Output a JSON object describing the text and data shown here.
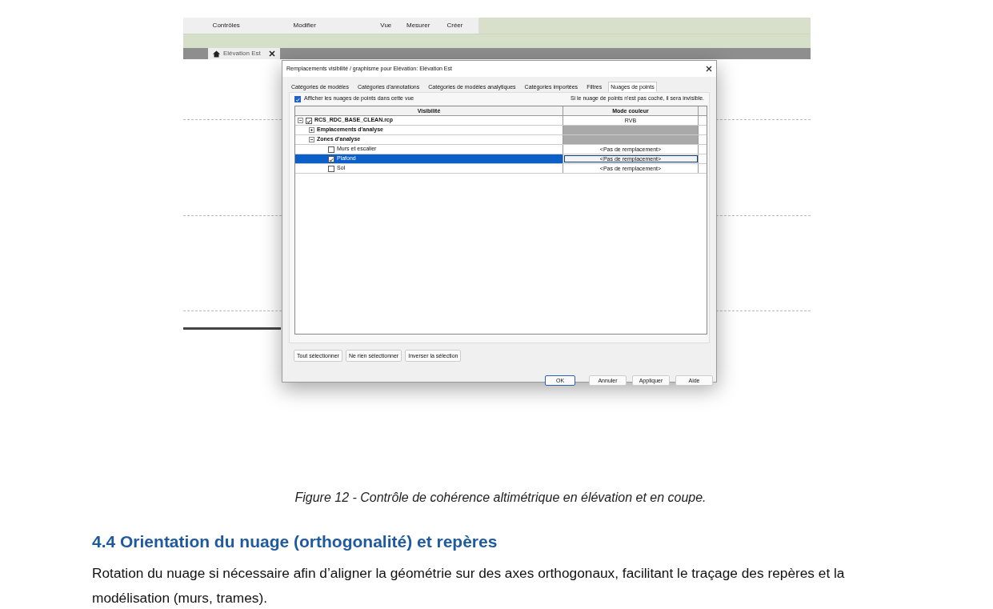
{
  "ribbon_tabs": [
    "Contrôles",
    "Modifier",
    "Vue",
    "Mesurer",
    "Créer"
  ],
  "view_tab": {
    "label": "Elévation Est"
  },
  "dialog": {
    "title": "Remplacements visibilité / graphisme pour Elévation: Elévation Est",
    "tabs": [
      {
        "label": "Catégories de modèles",
        "selected": false
      },
      {
        "label": "Catégories d'annotations",
        "selected": false
      },
      {
        "label": "Catégories de modèles analytiques",
        "selected": false
      },
      {
        "label": "Catégories importées",
        "selected": false
      },
      {
        "label": "Filtres",
        "selected": false
      },
      {
        "label": "Nuages de points",
        "selected": true
      }
    ],
    "show_checkbox": {
      "label": "Afficher les nuages de points dans cette vue",
      "checked": true
    },
    "note": "Si le nuage de points n'est pas coché, il sera invisible.",
    "columns": [
      "Visibilité",
      "Mode couleur"
    ],
    "rows": [
      {
        "label": "RCS_RDC_BASE_CLEAN.rcp",
        "checked": true,
        "expanded": true,
        "selected": false,
        "mode": "RVB",
        "children": [
          {
            "label": "Emplacements d'analyse",
            "expanded": false,
            "selected": false
          },
          {
            "label": "Zones d'analyse",
            "expanded": true,
            "selected": false,
            "children": [
              {
                "label": "Murs et escalier",
                "checked": false,
                "selected": false,
                "mode": "<Pas de remplacement>"
              },
              {
                "label": "Plafond",
                "checked": true,
                "selected": true,
                "mode": "<Pas de remplacement>"
              },
              {
                "label": "Sol",
                "checked": false,
                "selected": false,
                "mode": "<Pas de remplacement>"
              }
            ]
          }
        ]
      }
    ],
    "select_buttons": [
      "Tout sélectionner",
      "Ne rien sélectionner",
      "Inverser la sélection"
    ],
    "buttons": [
      {
        "label": "OK",
        "focused": true
      },
      {
        "label": "Annuler",
        "focused": false
      },
      {
        "label": "Appliquer",
        "focused": false
      },
      {
        "label": "Aide",
        "focused": false
      }
    ]
  },
  "caption": "Figure 12 - Contrôle de cohérence altimétrique en élévation et en coupe.",
  "heading": "4.4 Orientation du nuage (orthogonalité) et repères",
  "paragraph": "Rotation du nuage si nécessaire afin d’aligner la géométrie sur des axes orthogonaux, facilitant le traçage des repères et la modélisation (murs, trames)."
}
